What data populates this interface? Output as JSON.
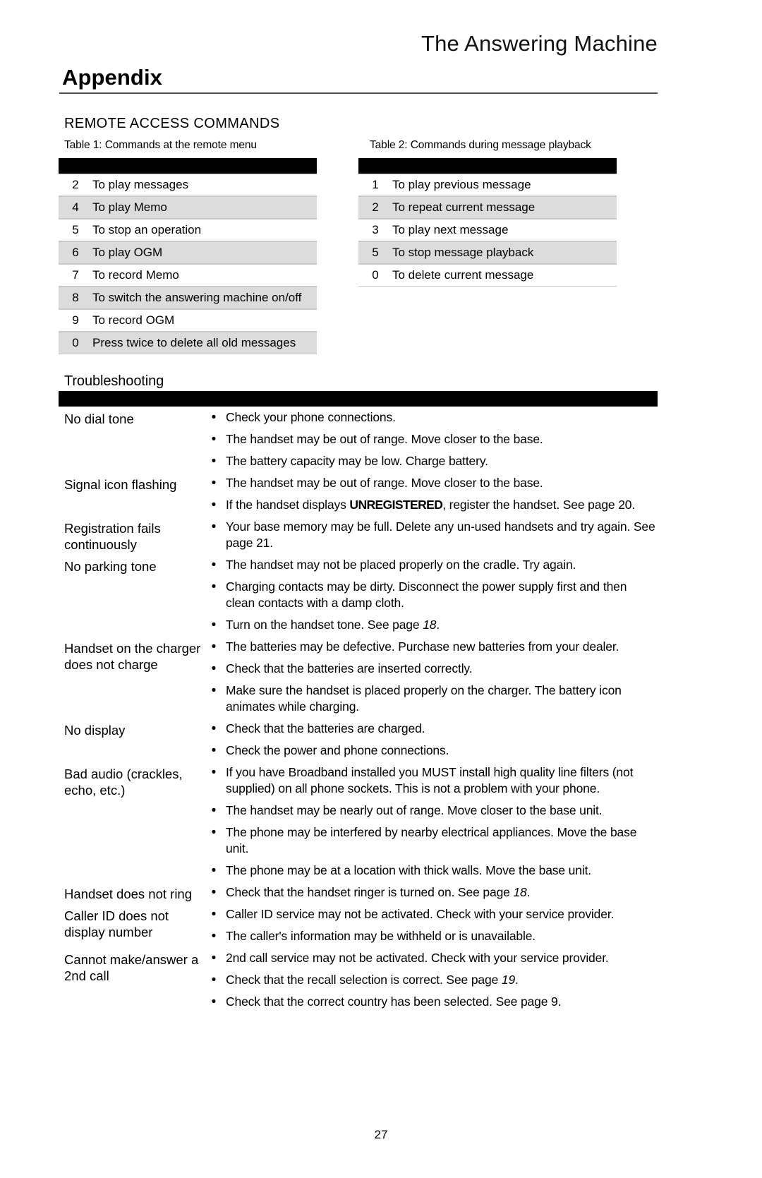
{
  "header": {
    "running_head": "The Answering Machine",
    "chapter_title": "Appendix"
  },
  "section": {
    "heading": "REMOTE ACCESS COMMANDS"
  },
  "tables": [
    {
      "caption": "Table 1: Commands at the remote menu",
      "rows": [
        {
          "key": "2",
          "value": "To play messages"
        },
        {
          "key": "4",
          "value": "To play Memo"
        },
        {
          "key": "5",
          "value": "To stop an operation"
        },
        {
          "key": "6",
          "value": "To play OGM"
        },
        {
          "key": "7",
          "value": "To record Memo"
        },
        {
          "key": "8",
          "value": "To switch the answering machine on/off"
        },
        {
          "key": "9",
          "value": "To record OGM"
        },
        {
          "key": "0",
          "value": "Press twice to delete all old messages"
        }
      ]
    },
    {
      "caption": "Table 2: Commands during message playback",
      "rows": [
        {
          "key": "1",
          "value": "To play previous message"
        },
        {
          "key": "2",
          "value": "To repeat current message"
        },
        {
          "key": "3",
          "value": "To play next message"
        },
        {
          "key": "5",
          "value": "To stop message playback"
        },
        {
          "key": "0",
          "value": "To delete current message"
        }
      ]
    }
  ],
  "troubleshooting": {
    "title": "Troubleshooting",
    "rows": [
      {
        "symptom": "No dial tone",
        "items": [
          "Check your phone connections.",
          "The handset may be out of range. Move closer to the base.",
          "The battery capacity may be low. Charge battery."
        ]
      },
      {
        "symptom": "Signal icon flashing",
        "items": [
          "The handset may be out of range. Move closer to the base.",
          "If the handset displays UNREGISTERED, register the handset. See page 20."
        ]
      },
      {
        "symptom": "Registration fails continuously",
        "items": [
          "Your base memory may be full. Delete any un-used handsets and try again. See page 21."
        ]
      },
      {
        "symptom": "No parking tone",
        "items": [
          "The handset may not be placed properly on the cradle. Try again.",
          "Charging contacts may be dirty. Disconnect the power supply first and then clean contacts with a damp cloth.",
          "Turn on the handset tone. See page 18."
        ]
      },
      {
        "symptom": "Handset on the charger does not charge",
        "items": [
          "The batteries may be defective. Purchase new batteries from your dealer.",
          "Check that the batteries are inserted correctly.",
          "Make sure the handset is placed properly on the charger. The battery icon animates while charging."
        ]
      },
      {
        "symptom": "No display",
        "items": [
          "Check that the batteries are charged.",
          "Check the power and phone connections."
        ]
      },
      {
        "symptom": "Bad audio (crackles, echo, etc.)",
        "items": [
          "If you have Broadband installed you MUST install high quality line filters (not supplied) on all phone sockets. This is not a problem with your phone.",
          "The handset may be nearly out of range. Move closer to the base unit.",
          "The phone may be interfered by nearby electrical appliances. Move the base unit.",
          "The phone may be at a location with thick walls. Move the base unit."
        ]
      },
      {
        "symptom": "Handset does not ring",
        "items": [
          "Check that the handset ringer is turned on. See page 18."
        ]
      },
      {
        "symptom": "Caller ID does not display number",
        "items": [
          "Caller ID service may not be activated. Check with your service provider.",
          "The caller's information may be withheld or is unavailable."
        ]
      },
      {
        "symptom": "Cannot make/answer a 2nd call",
        "items": [
          "2nd call service may not be activated. Check with your service provider.",
          "Check that the recall selection is correct. See page 19.",
          "Check that the correct country has been selected. See page 9."
        ]
      }
    ]
  },
  "footer": {
    "page_number": "27"
  }
}
